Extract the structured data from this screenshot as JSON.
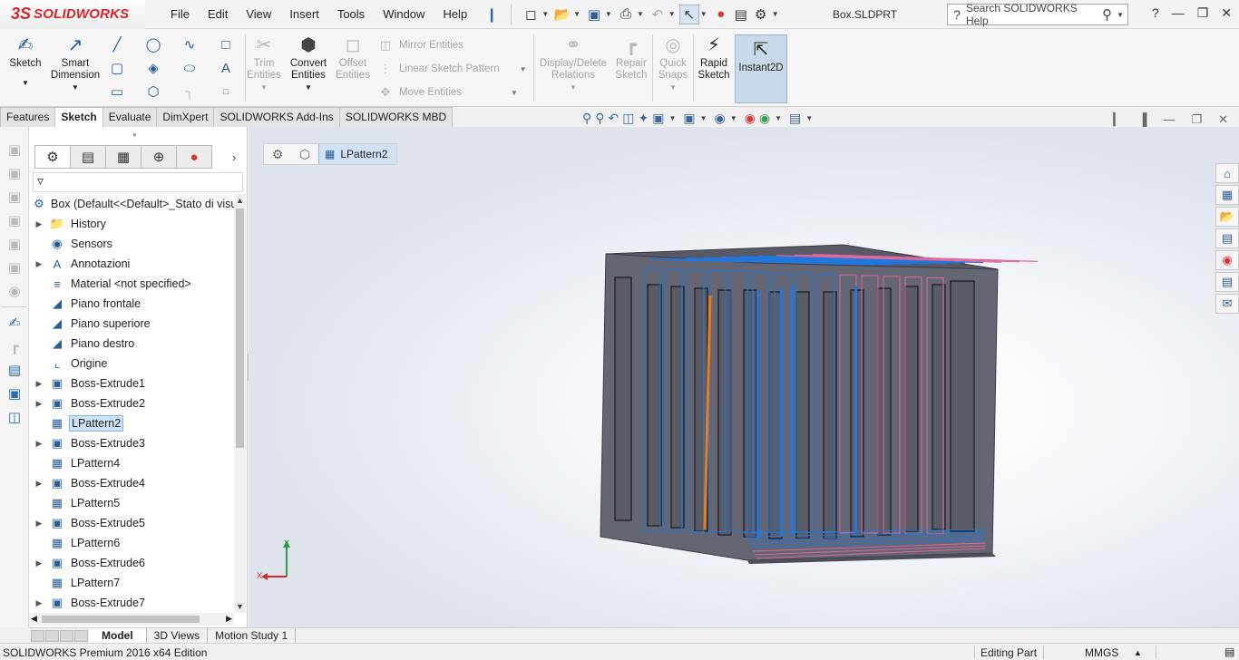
{
  "app": {
    "logo_prefix": "3S",
    "logo_text": "SOLIDWORKS",
    "document_title": "Box.SLDPRT",
    "search_placeholder": "Search SOLIDWORKS Help"
  },
  "menu": [
    "File",
    "Edit",
    "View",
    "Insert",
    "Tools",
    "Window",
    "Help"
  ],
  "command_manager": {
    "sketch": "Sketch",
    "smart_dimension_line1": "Smart",
    "smart_dimension_line2": "Dimension",
    "trim_line1": "Trim",
    "trim_line2": "Entities",
    "convert_line1": "Convert",
    "convert_line2": "Entities",
    "offset_line1": "Offset",
    "offset_line2": "Entities",
    "mirror_entities": "Mirror Entities",
    "linear_sketch_pattern": "Linear Sketch Pattern",
    "move_entities": "Move Entities",
    "display_delete_line1": "Display/Delete",
    "display_delete_line2": "Relations",
    "repair_line1": "Repair",
    "repair_line2": "Sketch",
    "quick_snaps_line1": "Quick",
    "quick_snaps_line2": "Snaps",
    "rapid_sketch_line1": "Rapid",
    "rapid_sketch_line2": "Sketch",
    "instant2d": "Instant2D"
  },
  "tabs": [
    {
      "label": "Features",
      "active": false
    },
    {
      "label": "Sketch",
      "active": true
    },
    {
      "label": "Evaluate",
      "active": false
    },
    {
      "label": "DimXpert",
      "active": false
    },
    {
      "label": "SOLIDWORKS Add-Ins",
      "active": false
    },
    {
      "label": "SOLIDWORKS MBD",
      "active": false
    }
  ],
  "feature_tree": {
    "root": "Box  (Default<<Default>_Stato di visua",
    "items": [
      {
        "label": "History",
        "icon": "folder-icon",
        "expandable": true,
        "selected": false,
        "indent": 1
      },
      {
        "label": "Sensors",
        "icon": "sensor-icon",
        "expandable": false,
        "selected": false,
        "indent": 1
      },
      {
        "label": "Annotazioni",
        "icon": "annotation-icon",
        "expandable": true,
        "selected": false,
        "indent": 1
      },
      {
        "label": "Material <not specified>",
        "icon": "material-icon",
        "expandable": false,
        "selected": false,
        "indent": 1
      },
      {
        "label": "Piano frontale",
        "icon": "plane-icon",
        "expandable": false,
        "selected": false,
        "indent": 1
      },
      {
        "label": "Piano superiore",
        "icon": "plane-icon",
        "expandable": false,
        "selected": false,
        "indent": 1
      },
      {
        "label": "Piano destro",
        "icon": "plane-icon",
        "expandable": false,
        "selected": false,
        "indent": 1
      },
      {
        "label": "Origine",
        "icon": "origin-icon",
        "expandable": false,
        "selected": false,
        "indent": 1
      },
      {
        "label": "Boss-Extrude1",
        "icon": "extrude-icon",
        "expandable": true,
        "selected": false,
        "indent": 1
      },
      {
        "label": "Boss-Extrude2",
        "icon": "extrude-icon",
        "expandable": true,
        "selected": false,
        "indent": 1
      },
      {
        "label": "LPattern2",
        "icon": "linear-pattern-icon",
        "expandable": false,
        "selected": true,
        "indent": 1
      },
      {
        "label": "Boss-Extrude3",
        "icon": "extrude-icon",
        "expandable": true,
        "selected": false,
        "indent": 1
      },
      {
        "label": "LPattern4",
        "icon": "linear-pattern-icon",
        "expandable": false,
        "selected": false,
        "indent": 1
      },
      {
        "label": "Boss-Extrude4",
        "icon": "extrude-icon",
        "expandable": true,
        "selected": false,
        "indent": 1
      },
      {
        "label": "LPattern5",
        "icon": "linear-pattern-icon",
        "expandable": false,
        "selected": false,
        "indent": 1
      },
      {
        "label": "Boss-Extrude5",
        "icon": "extrude-icon",
        "expandable": true,
        "selected": false,
        "indent": 1
      },
      {
        "label": "LPattern6",
        "icon": "linear-pattern-icon",
        "expandable": false,
        "selected": false,
        "indent": 1
      },
      {
        "label": "Boss-Extrude6",
        "icon": "extrude-icon",
        "expandable": true,
        "selected": false,
        "indent": 1
      },
      {
        "label": "LPattern7",
        "icon": "linear-pattern-icon",
        "expandable": false,
        "selected": false,
        "indent": 1
      },
      {
        "label": "Boss-Extrude7",
        "icon": "extrude-icon",
        "expandable": true,
        "selected": false,
        "indent": 1
      }
    ]
  },
  "breadcrumb": {
    "current": "LPattern2"
  },
  "model": {
    "body_color": "#646673",
    "highlight_blue": "#1f78e0",
    "highlight_pink": "#e2689e",
    "selected_orange": "#f47b13"
  },
  "bottom_tabs": [
    {
      "label": "Model",
      "active": true
    },
    {
      "label": "3D Views",
      "active": false
    },
    {
      "label": "Motion Study 1",
      "active": false
    }
  ],
  "status": {
    "edition": "SOLIDWORKS Premium 2016 x64 Edition",
    "mode": "Editing Part",
    "units": "MMGS"
  },
  "triad": {
    "x": "X",
    "y": "Y"
  }
}
